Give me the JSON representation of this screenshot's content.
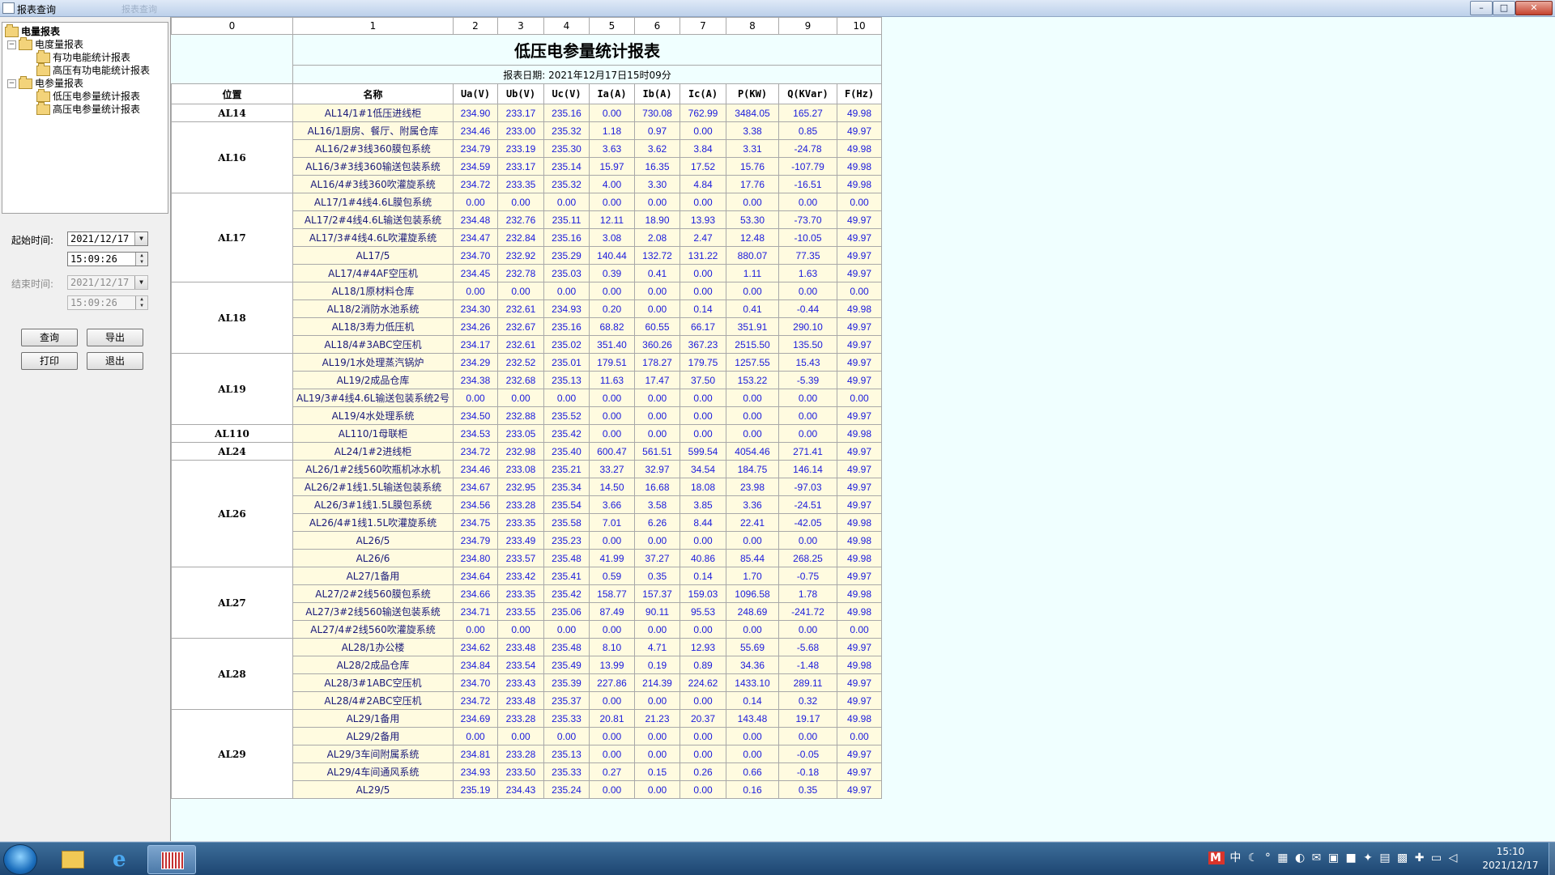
{
  "window": {
    "title": "报表查询",
    "ghost_title": "报表查询",
    "buttons": {
      "minimize": "–",
      "maximize": "□",
      "close": "✕"
    }
  },
  "tree": {
    "root": "电量报表",
    "groups": [
      {
        "label": "电度量报表",
        "children": [
          "有功电能统计报表",
          "高压有功电能统计报表"
        ]
      },
      {
        "label": "电参量报表",
        "children": [
          "低压电参量统计报表",
          "高压电参量统计报表"
        ]
      }
    ]
  },
  "filters": {
    "start_label": "起始时间:",
    "start_date": "2021/12/17",
    "start_time": "15:09:26",
    "end_label": "结束时间:",
    "end_date": "2021/12/17",
    "end_time": "15:09:26"
  },
  "buttons": {
    "query": "查询",
    "export": "导出",
    "print": "打印",
    "exit": "退出"
  },
  "report": {
    "col_numbers": [
      "0",
      "1",
      "2",
      "3",
      "4",
      "5",
      "6",
      "7",
      "8",
      "9",
      "10"
    ],
    "title": "低压电参量统计报表",
    "date_line": "报表日期:  2021年12月17日15时09分",
    "headers": [
      "位置",
      "名称",
      "Ua(V)",
      "Ub(V)",
      "Uc(V)",
      "Ia(A)",
      "Ib(A)",
      "Ic(A)",
      "P(KW)",
      "Q(KVar)",
      "F(Hz)"
    ],
    "groups": [
      {
        "loc": "AL14",
        "rows": [
          [
            "AL14/1#1低压进线柜",
            "234.90",
            "233.17",
            "235.16",
            "0.00",
            "730.08",
            "762.99",
            "3484.05",
            "165.27",
            "49.98"
          ]
        ]
      },
      {
        "loc": "AL16",
        "rows": [
          [
            "AL16/1厨房、餐厅、附属仓库",
            "234.46",
            "233.00",
            "235.32",
            "1.18",
            "0.97",
            "0.00",
            "3.38",
            "0.85",
            "49.97"
          ],
          [
            "AL16/2#3线360膜包系统",
            "234.79",
            "233.19",
            "235.30",
            "3.63",
            "3.62",
            "3.84",
            "3.31",
            "-24.78",
            "49.98"
          ],
          [
            "AL16/3#3线360输送包装系统",
            "234.59",
            "233.17",
            "235.14",
            "15.97",
            "16.35",
            "17.52",
            "15.76",
            "-107.79",
            "49.98"
          ],
          [
            "AL16/4#3线360吹灌旋系统",
            "234.72",
            "233.35",
            "235.32",
            "4.00",
            "3.30",
            "4.84",
            "17.76",
            "-16.51",
            "49.98"
          ]
        ]
      },
      {
        "loc": "AL17",
        "rows": [
          [
            "AL17/1#4线4.6L膜包系统",
            "0.00",
            "0.00",
            "0.00",
            "0.00",
            "0.00",
            "0.00",
            "0.00",
            "0.00",
            "0.00"
          ],
          [
            "AL17/2#4线4.6L输送包装系统",
            "234.48",
            "232.76",
            "235.11",
            "12.11",
            "18.90",
            "13.93",
            "53.30",
            "-73.70",
            "49.97"
          ],
          [
            "AL17/3#4线4.6L吹灌旋系统",
            "234.47",
            "232.84",
            "235.16",
            "3.08",
            "2.08",
            "2.47",
            "12.48",
            "-10.05",
            "49.97"
          ],
          [
            "AL17/5",
            "234.70",
            "232.92",
            "235.29",
            "140.44",
            "132.72",
            "131.22",
            "880.07",
            "77.35",
            "49.97"
          ],
          [
            "AL17/4#4AF空压机",
            "234.45",
            "232.78",
            "235.03",
            "0.39",
            "0.41",
            "0.00",
            "1.11",
            "1.63",
            "49.97"
          ]
        ]
      },
      {
        "loc": "AL18",
        "rows": [
          [
            "AL18/1原材料仓库",
            "0.00",
            "0.00",
            "0.00",
            "0.00",
            "0.00",
            "0.00",
            "0.00",
            "0.00",
            "0.00"
          ],
          [
            "AL18/2消防水池系统",
            "234.30",
            "232.61",
            "234.93",
            "0.20",
            "0.00",
            "0.14",
            "0.41",
            "-0.44",
            "49.98"
          ],
          [
            "AL18/3寿力低压机",
            "234.26",
            "232.67",
            "235.16",
            "68.82",
            "60.55",
            "66.17",
            "351.91",
            "290.10",
            "49.97"
          ],
          [
            "AL18/4#3ABC空压机",
            "234.17",
            "232.61",
            "235.02",
            "351.40",
            "360.26",
            "367.23",
            "2515.50",
            "135.50",
            "49.97"
          ]
        ]
      },
      {
        "loc": "AL19",
        "rows": [
          [
            "AL19/1水处理蒸汽锅炉",
            "234.29",
            "232.52",
            "235.01",
            "179.51",
            "178.27",
            "179.75",
            "1257.55",
            "15.43",
            "49.97"
          ],
          [
            "AL19/2成品仓库",
            "234.38",
            "232.68",
            "235.13",
            "11.63",
            "17.47",
            "37.50",
            "153.22",
            "-5.39",
            "49.97"
          ],
          [
            "AL19/3#4线4.6L输送包装系统2号",
            "0.00",
            "0.00",
            "0.00",
            "0.00",
            "0.00",
            "0.00",
            "0.00",
            "0.00",
            "0.00"
          ],
          [
            "AL19/4水处理系统",
            "234.50",
            "232.88",
            "235.52",
            "0.00",
            "0.00",
            "0.00",
            "0.00",
            "0.00",
            "49.97"
          ]
        ]
      },
      {
        "loc": "AL110",
        "rows": [
          [
            "AL110/1母联柜",
            "234.53",
            "233.05",
            "235.42",
            "0.00",
            "0.00",
            "0.00",
            "0.00",
            "0.00",
            "49.98"
          ]
        ]
      },
      {
        "loc": "AL24",
        "rows": [
          [
            "AL24/1#2进线柜",
            "234.72",
            "232.98",
            "235.40",
            "600.47",
            "561.51",
            "599.54",
            "4054.46",
            "271.41",
            "49.97"
          ]
        ]
      },
      {
        "loc": "AL26",
        "rows": [
          [
            "AL26/1#2线560吹瓶机冰水机",
            "234.46",
            "233.08",
            "235.21",
            "33.27",
            "32.97",
            "34.54",
            "184.75",
            "146.14",
            "49.97"
          ],
          [
            "AL26/2#1线1.5L输送包装系统",
            "234.67",
            "232.95",
            "235.34",
            "14.50",
            "16.68",
            "18.08",
            "23.98",
            "-97.03",
            "49.97"
          ],
          [
            "AL26/3#1线1.5L膜包系统",
            "234.56",
            "233.28",
            "235.54",
            "3.66",
            "3.58",
            "3.85",
            "3.36",
            "-24.51",
            "49.97"
          ],
          [
            "AL26/4#1线1.5L吹灌旋系统",
            "234.75",
            "233.35",
            "235.58",
            "7.01",
            "6.26",
            "8.44",
            "22.41",
            "-42.05",
            "49.98"
          ],
          [
            "AL26/5",
            "234.79",
            "233.49",
            "235.23",
            "0.00",
            "0.00",
            "0.00",
            "0.00",
            "0.00",
            "49.98"
          ],
          [
            "AL26/6",
            "234.80",
            "233.57",
            "235.48",
            "41.99",
            "37.27",
            "40.86",
            "85.44",
            "268.25",
            "49.98"
          ]
        ]
      },
      {
        "loc": "AL27",
        "rows": [
          [
            "AL27/1备用",
            "234.64",
            "233.42",
            "235.41",
            "0.59",
            "0.35",
            "0.14",
            "1.70",
            "-0.75",
            "49.97"
          ],
          [
            "AL27/2#2线560膜包系统",
            "234.66",
            "233.35",
            "235.42",
            "158.77",
            "157.37",
            "159.03",
            "1096.58",
            "1.78",
            "49.98"
          ],
          [
            "AL27/3#2线560输送包装系统",
            "234.71",
            "233.55",
            "235.06",
            "87.49",
            "90.11",
            "95.53",
            "248.69",
            "-241.72",
            "49.98"
          ],
          [
            "AL27/4#2线560吹灌旋系统",
            "0.00",
            "0.00",
            "0.00",
            "0.00",
            "0.00",
            "0.00",
            "0.00",
            "0.00",
            "0.00"
          ]
        ]
      },
      {
        "loc": "AL28",
        "rows": [
          [
            "AL28/1办公楼",
            "234.62",
            "233.48",
            "235.48",
            "8.10",
            "4.71",
            "12.93",
            "55.69",
            "-5.68",
            "49.97"
          ],
          [
            "AL28/2成品仓库",
            "234.84",
            "233.54",
            "235.49",
            "13.99",
            "0.19",
            "0.89",
            "34.36",
            "-1.48",
            "49.98"
          ],
          [
            "AL28/3#1ABC空压机",
            "234.70",
            "233.43",
            "235.39",
            "227.86",
            "214.39",
            "224.62",
            "1433.10",
            "289.11",
            "49.97"
          ],
          [
            "AL28/4#2ABC空压机",
            "234.72",
            "233.48",
            "235.37",
            "0.00",
            "0.00",
            "0.00",
            "0.14",
            "0.32",
            "49.97"
          ]
        ]
      },
      {
        "loc": "AL29",
        "rows": [
          [
            "AL29/1备用",
            "234.69",
            "233.28",
            "235.33",
            "20.81",
            "21.23",
            "20.37",
            "143.48",
            "19.17",
            "49.98"
          ],
          [
            "AL29/2备用",
            "0.00",
            "0.00",
            "0.00",
            "0.00",
            "0.00",
            "0.00",
            "0.00",
            "0.00",
            "0.00"
          ],
          [
            "AL29/3车间附属系统",
            "234.81",
            "233.28",
            "235.13",
            "0.00",
            "0.00",
            "0.00",
            "0.00",
            "-0.05",
            "49.97"
          ],
          [
            "AL29/4车间通风系统",
            "234.93",
            "233.50",
            "235.33",
            "0.27",
            "0.15",
            "0.26",
            "0.66",
            "-0.18",
            "49.97"
          ],
          [
            "AL29/5",
            "235.19",
            "234.43",
            "235.24",
            "0.00",
            "0.00",
            "0.00",
            "0.16",
            "0.35",
            "49.97"
          ]
        ]
      }
    ]
  },
  "taskbar": {
    "tray_ime": "M",
    "tray_lang": "中",
    "time": "15:10",
    "date": "2021/12/17"
  }
}
